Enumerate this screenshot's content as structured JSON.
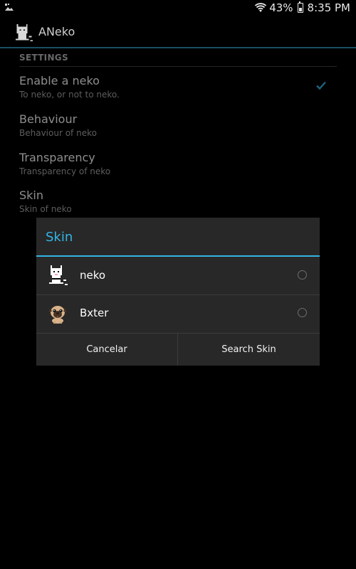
{
  "status_bar": {
    "battery_percent": "43%",
    "time": "8:35 PM",
    "icons": [
      "notification-icon",
      "wifi-icon",
      "battery-icon"
    ]
  },
  "app_bar": {
    "title": "ANeko",
    "icon": "neko-cat-icon"
  },
  "settings": {
    "category": "SETTINGS",
    "items": [
      {
        "title": "Enable a neko",
        "summary": "To neko, or not to neko.",
        "checked": true
      },
      {
        "title": "Behaviour",
        "summary": "Behaviour of neko"
      },
      {
        "title": "Transparency",
        "summary": "Transparency of neko"
      },
      {
        "title": "Skin",
        "summary": "Skin of neko"
      }
    ]
  },
  "dialog": {
    "title": "Skin",
    "options": [
      {
        "label": "neko",
        "icon": "neko-cat-icon",
        "selected": false
      },
      {
        "label": "Bxter",
        "icon": "pug-dog-icon",
        "selected": false
      }
    ],
    "buttons": {
      "negative": "Cancelar",
      "positive": "Search Skin"
    }
  },
  "colors": {
    "accent": "#33b5e5",
    "background": "#000000",
    "dialog_bg": "#282828"
  }
}
